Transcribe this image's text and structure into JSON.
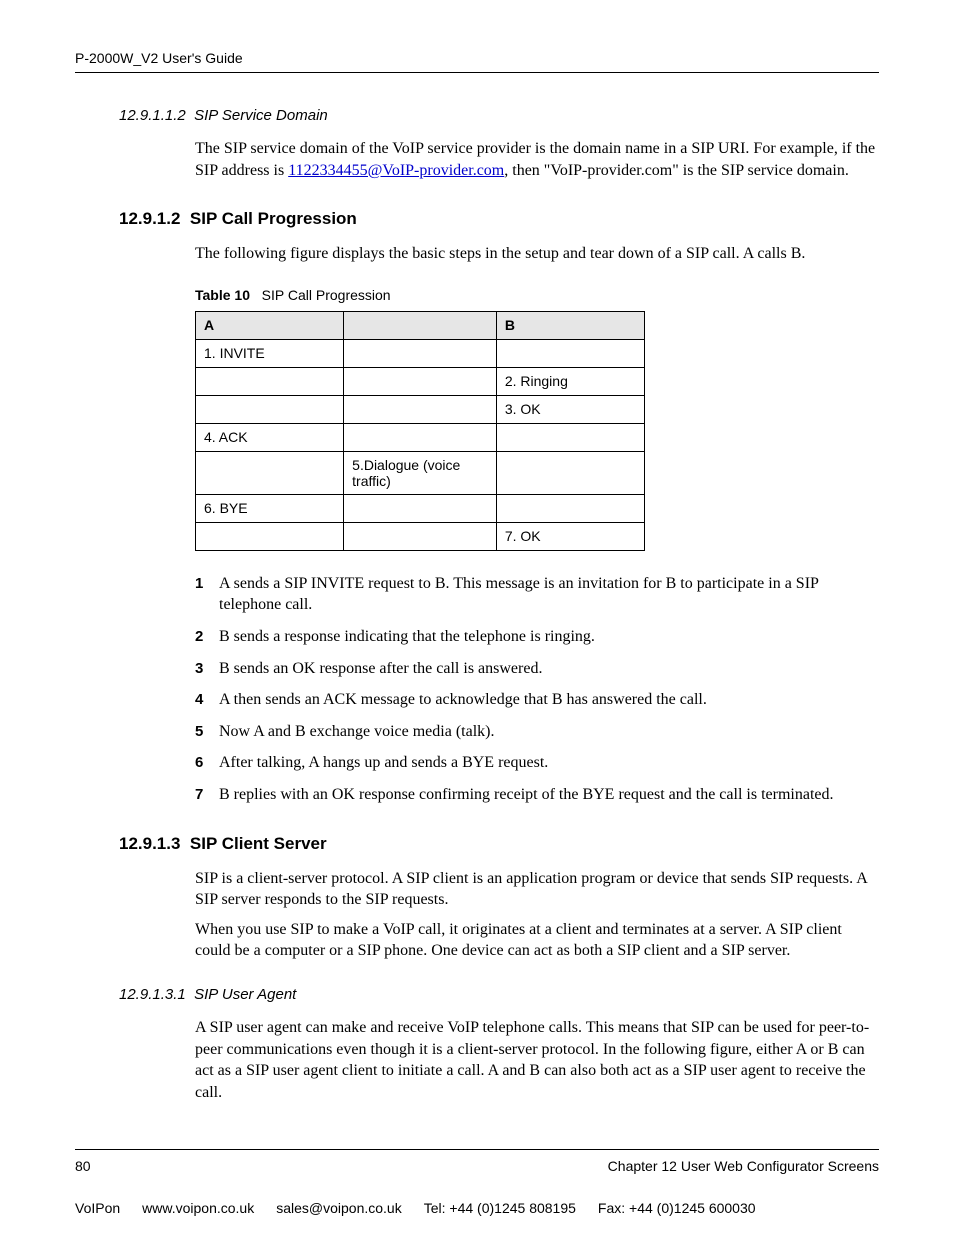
{
  "header": {
    "title": "P-2000W_V2 User's Guide"
  },
  "s1": {
    "num": "12.9.1.1.2",
    "title": "SIP Service Domain",
    "para_a": "The SIP service domain of the VoIP service provider is the domain name in a SIP URI. For example, if the SIP address is ",
    "link": "1122334455@VoIP-provider.com",
    "para_b": ", then \"VoIP-provider.com\" is the SIP service domain."
  },
  "s2": {
    "num": "12.9.1.2",
    "title": "SIP Call Progression",
    "intro": "The following figure displays the basic steps in the setup and tear down of a SIP call. A calls B.",
    "table_label": "Table 10",
    "table_caption": "SIP Call Progression",
    "cols": {
      "a": "A",
      "mid": "",
      "b": "B"
    },
    "rows": [
      {
        "a": "1. INVITE",
        "mid": "",
        "b": ""
      },
      {
        "a": "",
        "mid": "",
        "b": "2. Ringing"
      },
      {
        "a": "",
        "mid": "",
        "b": "3. OK"
      },
      {
        "a": "4. ACK",
        "mid": "",
        "b": ""
      },
      {
        "a": "",
        "mid": "5.Dialogue (voice traffic)",
        "b": ""
      },
      {
        "a": "6. BYE",
        "mid": "",
        "b": ""
      },
      {
        "a": "",
        "mid": "",
        "b": "7. OK"
      }
    ],
    "steps": [
      "A sends a SIP INVITE request to B. This message is an invitation for B to participate in a SIP telephone call.",
      "B sends a response indicating that the telephone is ringing.",
      "B sends an OK response after the call is answered.",
      "A then sends an ACK message to acknowledge that B has answered the call.",
      "Now A and B exchange voice media (talk).",
      "After talking, A hangs up and sends a BYE request.",
      "B replies with an OK response confirming receipt of the BYE request and the call is terminated."
    ]
  },
  "s3": {
    "num": "12.9.1.3",
    "title": "SIP Client Server",
    "p1": "SIP is a client-server protocol. A SIP client is an application program or device that sends SIP requests. A SIP server responds to the SIP requests.",
    "p2": "When you use SIP to make a VoIP call, it originates at a client and terminates at a server. A SIP client could be a computer or a SIP phone. One device can act as both a SIP client and a SIP server."
  },
  "s4": {
    "num": "12.9.1.3.1",
    "title": "SIP User Agent",
    "p1": "A SIP user agent can make and receive VoIP telephone calls. This means that SIP can be used for peer-to-peer communications even though it is a client-server protocol. In the following figure, either A or B can act as a SIP user agent client to initiate a call. A and B can also both act as a SIP user agent to receive the call."
  },
  "footer": {
    "page": "80",
    "chapter": "Chapter 12 User Web Configurator Screens"
  },
  "vendor": {
    "name": "VoIPon",
    "url": "www.voipon.co.uk",
    "email": "sales@voipon.co.uk",
    "tel": "Tel: +44 (0)1245 808195",
    "fax": "Fax: +44 (0)1245 600030"
  }
}
